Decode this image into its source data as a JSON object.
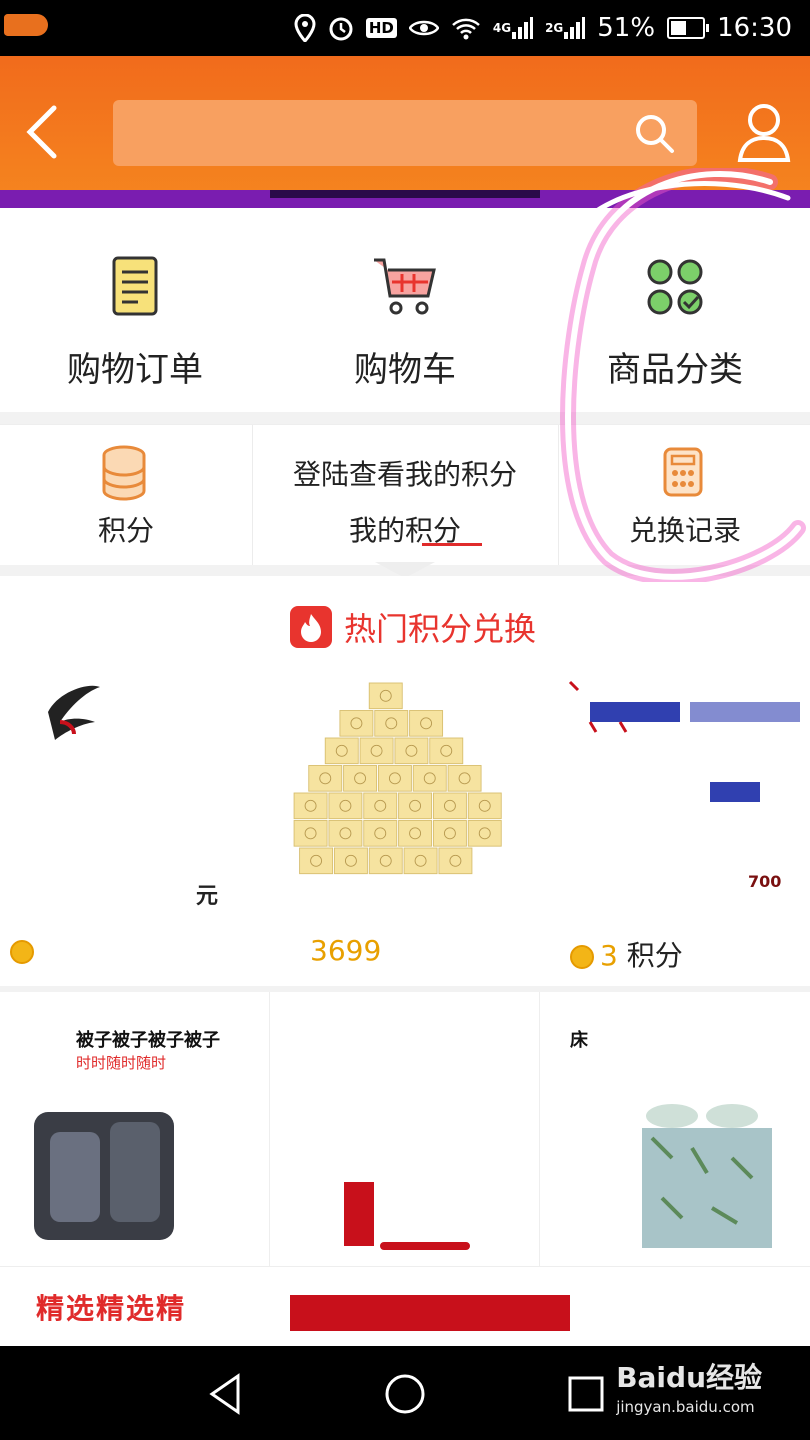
{
  "status_bar": {
    "network_1": "4G",
    "network_2": "2G",
    "battery": "51%",
    "battery_level": 0.51,
    "time": "16:30",
    "hd": "HD"
  },
  "header": {
    "search_placeholder": ""
  },
  "quick_entries": [
    {
      "label": "购物订单",
      "icon": "order-list-icon"
    },
    {
      "label": "购物车",
      "icon": "shopping-cart-icon"
    },
    {
      "label": "商品分类",
      "icon": "category-grid-icon"
    }
  ],
  "points": {
    "left_label": "积分",
    "login_prompt": "登陆查看我的积分",
    "my_points": "我的积分",
    "right_label": "兑换记录"
  },
  "hot_section": {
    "title": "热门积分兑换",
    "products": [
      {
        "price": "",
        "unit": "",
        "tag": "元"
      },
      {
        "price": "3699",
        "unit": "",
        "tag": ""
      },
      {
        "price": "3",
        "unit": "积分",
        "tag": "700"
      }
    ]
  },
  "grid_items": [
    {
      "line1": "被子被子被子被子",
      "line2": "时时随时随时"
    },
    {
      "line1": "",
      "line2": ""
    },
    {
      "line1": "床",
      "line2": ""
    }
  ],
  "bottom": {
    "featured": "精选精选精"
  },
  "watermark": {
    "brand": "Baidu经验",
    "url": "jingyan.baidu.com"
  },
  "colors": {
    "header_orange": "#f16b1c",
    "accent_red": "#e8342e",
    "annotation_pink": "#f25bc8"
  }
}
